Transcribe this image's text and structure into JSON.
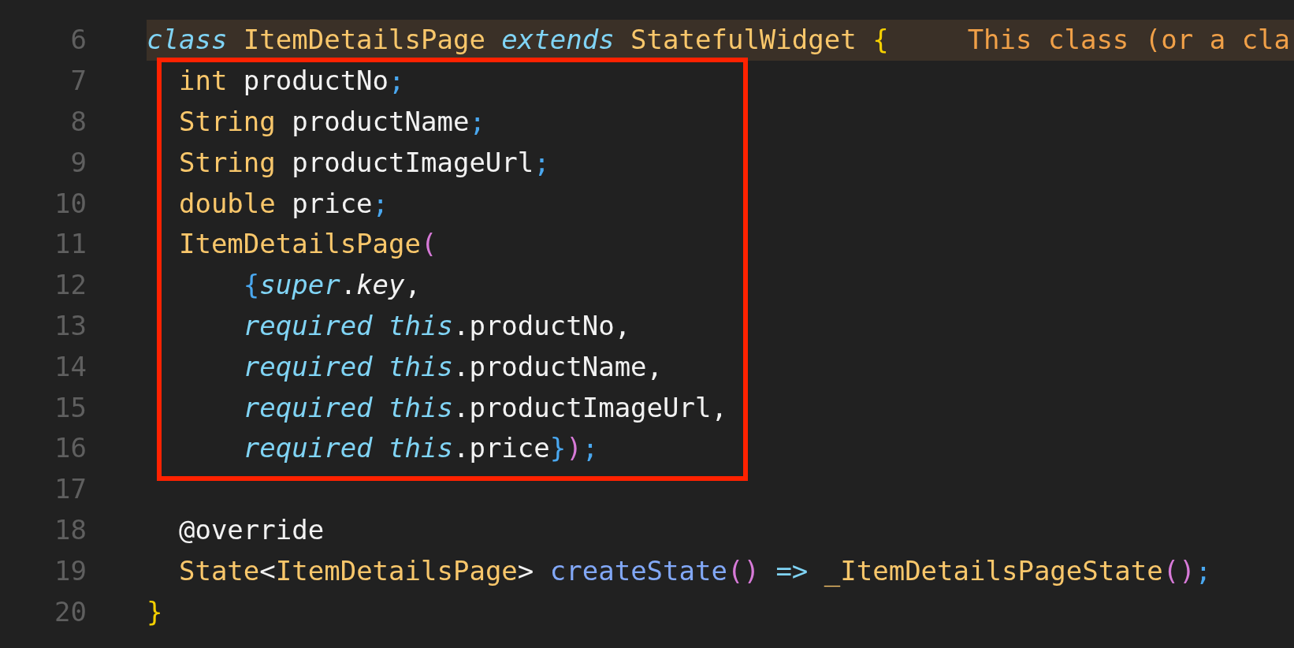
{
  "editor": {
    "lines": [
      {
        "number": "6",
        "highlighted": true,
        "tokens": [
          {
            "kind": "keyword",
            "text": "class"
          },
          {
            "kind": "type",
            "text": " ItemDetailsPage"
          },
          {
            "kind": "keyword",
            "text": " extends"
          },
          {
            "kind": "type",
            "text": " StatefulWidget"
          },
          {
            "kind": "brace",
            "text": " {"
          }
        ],
        "hint": "This class (or a cla"
      },
      {
        "number": "7",
        "highlighted": false,
        "tokens": [
          {
            "kind": "type",
            "text": "  int"
          },
          {
            "kind": "ident",
            "text": " productNo"
          },
          {
            "kind": "punct",
            "text": ";"
          }
        ]
      },
      {
        "number": "8",
        "highlighted": false,
        "tokens": [
          {
            "kind": "type",
            "text": "  String"
          },
          {
            "kind": "ident",
            "text": " productName"
          },
          {
            "kind": "punct",
            "text": ";"
          }
        ]
      },
      {
        "number": "9",
        "highlighted": false,
        "tokens": [
          {
            "kind": "type",
            "text": "  String"
          },
          {
            "kind": "ident",
            "text": " productImageUrl"
          },
          {
            "kind": "punct",
            "text": ";"
          }
        ]
      },
      {
        "number": "10",
        "highlighted": false,
        "tokens": [
          {
            "kind": "type",
            "text": "  double"
          },
          {
            "kind": "ident",
            "text": " price"
          },
          {
            "kind": "punct",
            "text": ";"
          }
        ]
      },
      {
        "number": "11",
        "highlighted": false,
        "tokens": [
          {
            "kind": "type",
            "text": "  ItemDetailsPage"
          },
          {
            "kind": "paren",
            "text": "("
          }
        ]
      },
      {
        "number": "12",
        "highlighted": false,
        "tokens": [
          {
            "kind": "punct",
            "text": "      {"
          },
          {
            "kind": "keyword",
            "text": "super"
          },
          {
            "kind": "ident",
            "text": "."
          },
          {
            "kind": "param",
            "text": "key"
          },
          {
            "kind": "ident",
            "text": ","
          }
        ]
      },
      {
        "number": "13",
        "highlighted": false,
        "tokens": [
          {
            "kind": "keyword",
            "text": "      required this"
          },
          {
            "kind": "ident",
            "text": ".productNo,"
          }
        ]
      },
      {
        "number": "14",
        "highlighted": false,
        "tokens": [
          {
            "kind": "keyword",
            "text": "      required this"
          },
          {
            "kind": "ident",
            "text": ".productName,"
          }
        ]
      },
      {
        "number": "15",
        "highlighted": false,
        "tokens": [
          {
            "kind": "keyword",
            "text": "      required this"
          },
          {
            "kind": "ident",
            "text": ".productImageUrl,"
          }
        ]
      },
      {
        "number": "16",
        "highlighted": false,
        "tokens": [
          {
            "kind": "keyword",
            "text": "      required this"
          },
          {
            "kind": "ident",
            "text": ".price"
          },
          {
            "kind": "punct",
            "text": "}"
          },
          {
            "kind": "paren",
            "text": ")"
          },
          {
            "kind": "punct",
            "text": ";"
          }
        ]
      },
      {
        "number": "17",
        "highlighted": false
      },
      {
        "number": "18",
        "highlighted": false,
        "tokens": [
          {
            "kind": "ident",
            "text": "  @override"
          }
        ]
      },
      {
        "number": "19",
        "highlighted": false,
        "tokens": [
          {
            "kind": "type",
            "text": "  State"
          },
          {
            "kind": "ident",
            "text": "<"
          },
          {
            "kind": "type",
            "text": "ItemDetailsPage"
          },
          {
            "kind": "ident",
            "text": "> "
          },
          {
            "kind": "method",
            "text": "createState"
          },
          {
            "kind": "paren",
            "text": "()"
          },
          {
            "kind": "keyword",
            "text": " =>"
          },
          {
            "kind": "type",
            "text": " _ItemDetailsPageState"
          },
          {
            "kind": "paren",
            "text": "()"
          },
          {
            "kind": "punct",
            "text": ";"
          }
        ]
      },
      {
        "number": "20",
        "highlighted": false,
        "tokens": [
          {
            "kind": "brace",
            "text": "}"
          }
        ]
      }
    ]
  }
}
